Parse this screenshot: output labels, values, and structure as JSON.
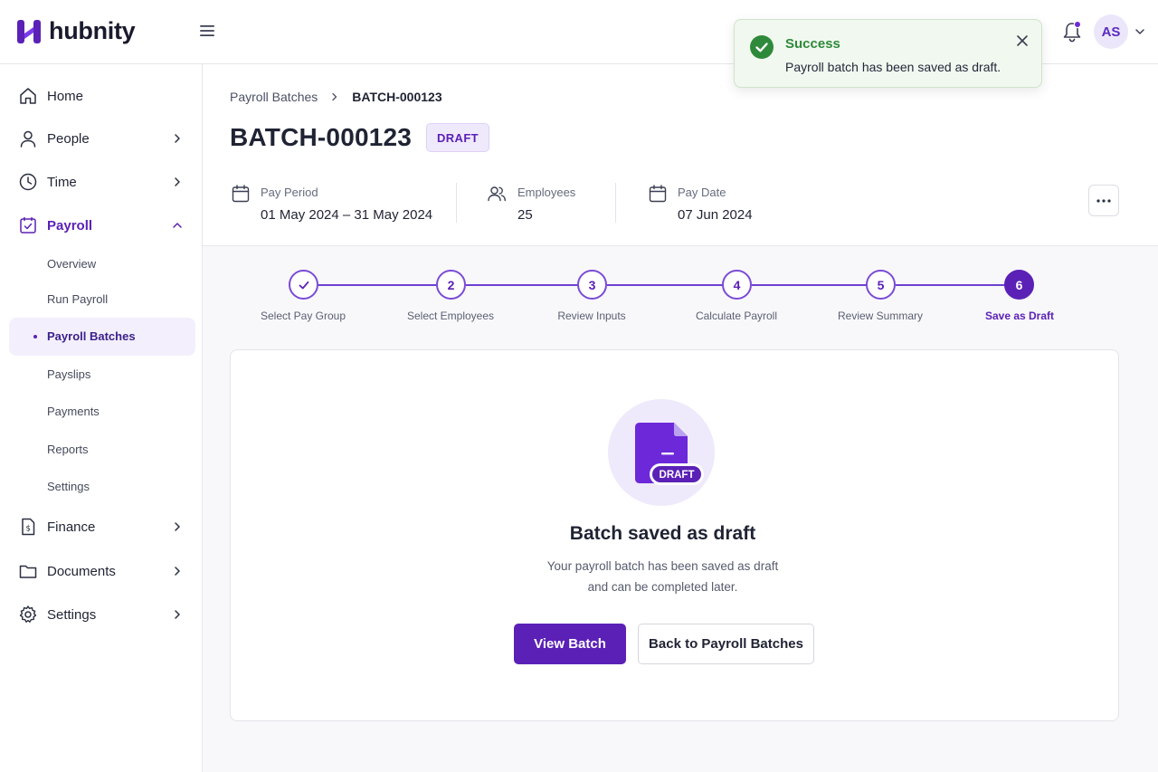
{
  "app": {
    "name": "hubnity",
    "brand_color": "#5b21b6"
  },
  "topbar": {
    "menu_icon": "hamburger-icon",
    "notification_icon": "bell-icon",
    "avatar_initials": "AS"
  },
  "toast": {
    "title": "Success",
    "message": "Payroll batch has been saved as draft.",
    "color": "#2e8a3a"
  },
  "sidebar": {
    "items": [
      {
        "label": "Home",
        "icon": "home-icon"
      },
      {
        "label": "People",
        "icon": "user-icon"
      },
      {
        "label": "Time",
        "icon": "clock-icon"
      },
      {
        "label": "Payroll",
        "icon": "payroll-icon"
      },
      {
        "label": "Finance",
        "icon": "finance-icon"
      },
      {
        "label": "Documents",
        "icon": "folder-icon"
      },
      {
        "label": "Settings",
        "icon": "gear-icon"
      }
    ],
    "payroll_sub": [
      {
        "label": "Overview"
      },
      {
        "label": "Run Payroll"
      },
      {
        "label": "Payroll Batches",
        "selected": true
      },
      {
        "label": "Payslips"
      },
      {
        "label": "Payments"
      },
      {
        "label": "Reports"
      },
      {
        "label": "Settings"
      }
    ]
  },
  "breadcrumb": {
    "parent": "Payroll Batches",
    "current": "BATCH-000123"
  },
  "page": {
    "title": "BATCH-000123",
    "status": "DRAFT"
  },
  "meta": {
    "pay_period": {
      "label": "Pay Period",
      "value": "01 May 2024 – 31 May 2024"
    },
    "employees": {
      "label": "Employees",
      "value": "25"
    },
    "pay_date": {
      "label": "Pay Date",
      "value": "07 Jun 2024"
    }
  },
  "stepper": {
    "steps": [
      {
        "number": "✓",
        "label": "Select Pay Group",
        "state": "done"
      },
      {
        "number": "2",
        "label": "Select Employees",
        "state": "done"
      },
      {
        "number": "3",
        "label": "Review Inputs",
        "state": "done"
      },
      {
        "number": "4",
        "label": "Calculate Payroll",
        "state": "done"
      },
      {
        "number": "5",
        "label": "Review Summary",
        "state": "done"
      },
      {
        "number": "6",
        "label": "Save as Draft",
        "state": "current"
      }
    ]
  },
  "card": {
    "illustration_badge": "DRAFT",
    "title": "Batch saved as draft",
    "description_line1": "Your payroll batch has been saved as draft",
    "description_line2": "and can be completed later.",
    "primary_button": "View Batch",
    "secondary_button": "Back to Payroll Batches"
  }
}
